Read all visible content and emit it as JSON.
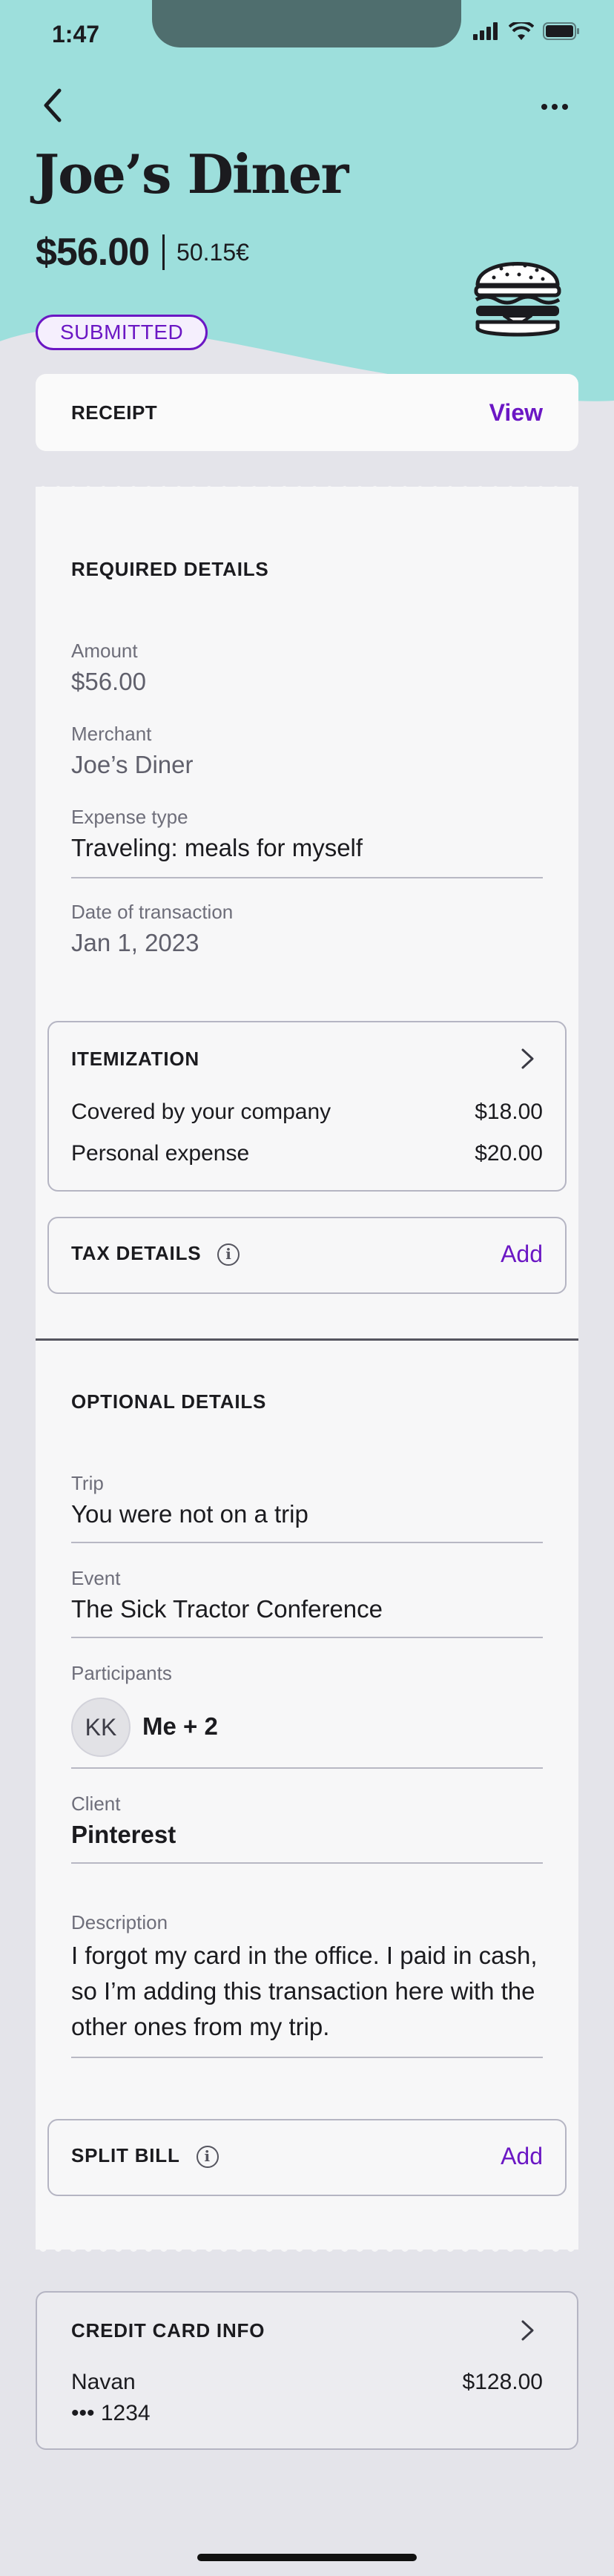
{
  "status_bar": {
    "time": "1:47"
  },
  "header": {
    "title": "Joe’s Diner",
    "amount": "$56.00",
    "amount_converted": "50.15€",
    "status_badge": "SUBMITTED",
    "icons": {
      "back": "chevron-left-icon",
      "more": "more-horizontal-icon",
      "category": "burger-icon"
    },
    "colors": {
      "header_bg": "#9ddfdc",
      "accent": "#6b17c4"
    }
  },
  "receipt": {
    "label": "RECEIPT",
    "action": "View"
  },
  "required_details": {
    "title": "REQUIRED DETAILS",
    "amount_label": "Amount",
    "amount_value": "$56.00",
    "merchant_label": "Merchant",
    "merchant_value": "Joe’s Diner",
    "expense_type_label": "Expense type",
    "expense_type_value": "Traveling: meals for myself",
    "date_label": "Date of transaction",
    "date_value": "Jan 1, 2023"
  },
  "itemization": {
    "title": "ITEMIZATION",
    "rows": [
      {
        "label": "Covered by your company",
        "value": "$18.00"
      },
      {
        "label": "Personal expense",
        "value": "$20.00"
      }
    ]
  },
  "tax_details": {
    "title": "TAX DETAILS",
    "action": "Add"
  },
  "optional_details": {
    "title": "OPTIONAL DETAILS",
    "trip_label": "Trip",
    "trip_value": "You were not on a trip",
    "event_label": "Event",
    "event_value": "The Sick Tractor Conference",
    "participants_label": "Participants",
    "participants_initials": "KK",
    "participants_value": "Me + 2",
    "client_label": "Client",
    "client_value": "Pinterest",
    "description_label": "Description",
    "description_value": "I forgot my card in the office. I paid in cash, so I’m adding this transaction here with the other ones from my trip."
  },
  "split_bill": {
    "title": "SPLIT BILL",
    "action": "Add"
  },
  "credit_card": {
    "title": "CREDIT CARD INFO",
    "card_name": "Navan",
    "card_number": "••• 1234",
    "amount": "$128.00"
  }
}
